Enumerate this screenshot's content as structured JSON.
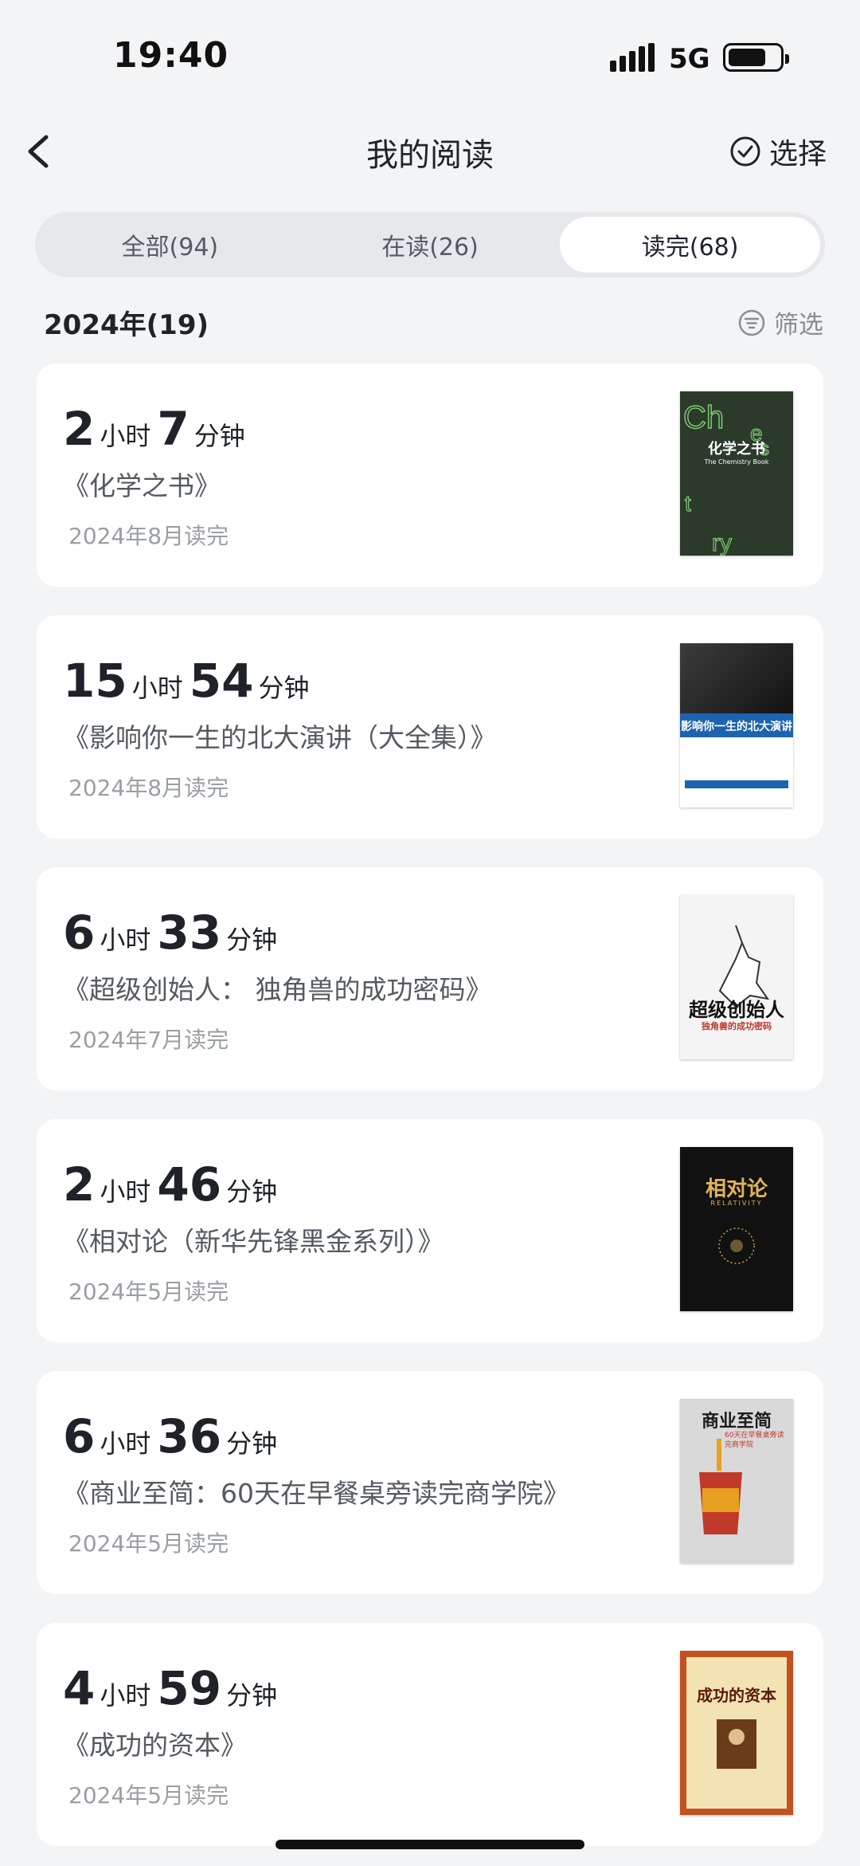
{
  "status": {
    "time": "19:40",
    "network": "5G"
  },
  "nav": {
    "title": "我的阅读",
    "select_label": "选择"
  },
  "tabs": [
    {
      "label": "全部(94)",
      "active": false
    },
    {
      "label": "在读(26)",
      "active": false
    },
    {
      "label": "读完(68)",
      "active": true
    }
  ],
  "section": {
    "year_label": "2024年(19)",
    "filter_label": "筛选"
  },
  "units": {
    "hour": "小时",
    "minute": "分钟"
  },
  "books": [
    {
      "hours": "2",
      "minutes": "7",
      "title": "《化学之书》",
      "date": "2024年8月读完",
      "cover": {
        "title": "化学之书",
        "subtitle": "The Chemistry Book",
        "bg": "#2b3a2a",
        "fg": "#ffffff"
      }
    },
    {
      "hours": "15",
      "minutes": "54",
      "title": "《影响你一生的北大演讲（大全集）》",
      "date": "2024年8月读完",
      "cover": {
        "title": "影响你一生的北大演讲",
        "bg": "#1c63b0",
        "fg": "#ffffff"
      }
    },
    {
      "hours": "6",
      "minutes": "33",
      "title": "《超级创始人： 独角兽的成功密码》",
      "date": "2024年7月读完",
      "cover": {
        "title": "超级创始人",
        "subtitle": "独角兽的成功密码",
        "bg": "#f4f4f4",
        "fg": "#1b1b1b"
      }
    },
    {
      "hours": "2",
      "minutes": "46",
      "title": "《相对论（新华先锋黑金系列）》",
      "date": "2024年5月读完",
      "cover": {
        "title": "相对论",
        "subtitle": "RELATIVITY",
        "bg": "#111111",
        "fg": "#e2b45a"
      }
    },
    {
      "hours": "6",
      "minutes": "36",
      "title": "《商业至简：60天在早餐桌旁读完商学院》",
      "date": "2024年5月读完",
      "cover": {
        "title": "商业至简",
        "subtitle": "60天在早餐桌旁读完商学院",
        "bg": "#d9d9d9",
        "fg": "#1b1b1b"
      }
    },
    {
      "hours": "4",
      "minutes": "59",
      "title": "《成功的资本》",
      "date": "2024年5月读完",
      "cover": {
        "title": "成功的资本",
        "bg": "#f3e3b3",
        "fg": "#5a1a0a"
      }
    }
  ]
}
